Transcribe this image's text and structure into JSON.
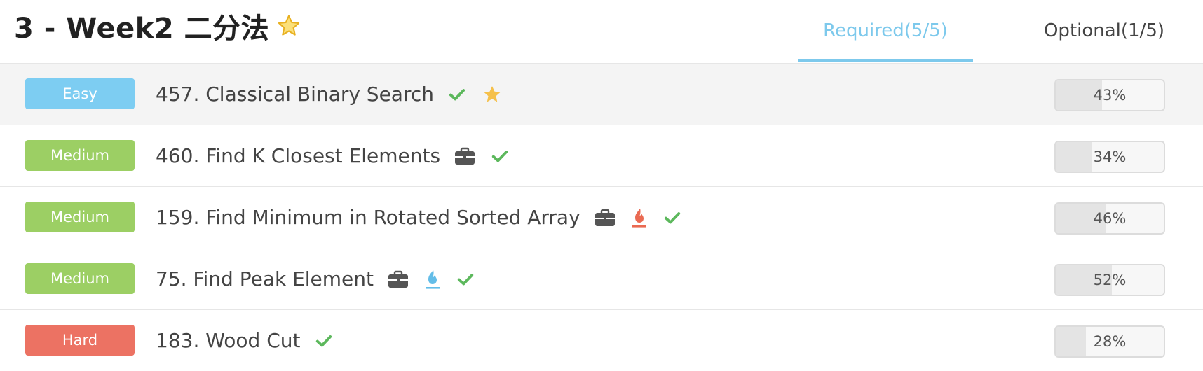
{
  "header": {
    "title": "3 - Week2 二分法",
    "title_icon": "star-outline-icon",
    "tabs": [
      {
        "label": "Required(5/5)",
        "active": true
      },
      {
        "label": "Optional(1/5)",
        "active": false
      }
    ]
  },
  "colors": {
    "accent": "#7dc9ec",
    "easy": "#7dcdf2",
    "medium": "#9ccf64",
    "hard": "#ec7263",
    "check": "#5cb85c",
    "star": "#f5c04a",
    "fire_red": "#ea6a52",
    "fire_blue": "#63bde8",
    "briefcase": "#555555"
  },
  "problems": [
    {
      "difficulty": "Easy",
      "title": "457. Classical Binary Search",
      "icons": [
        "check-icon",
        "star-icon"
      ],
      "progress": "43%",
      "progress_value": 43
    },
    {
      "difficulty": "Medium",
      "title": "460. Find K Closest Elements",
      "icons": [
        "briefcase-icon",
        "check-icon"
      ],
      "progress": "34%",
      "progress_value": 34
    },
    {
      "difficulty": "Medium",
      "title": "159. Find Minimum in Rotated Sorted Array",
      "icons": [
        "briefcase-icon",
        "fire-red-icon",
        "check-icon"
      ],
      "progress": "46%",
      "progress_value": 46
    },
    {
      "difficulty": "Medium",
      "title": "75. Find Peak Element",
      "icons": [
        "briefcase-icon",
        "fire-blue-icon",
        "check-icon"
      ],
      "progress": "52%",
      "progress_value": 52
    },
    {
      "difficulty": "Hard",
      "title": "183. Wood Cut",
      "icons": [
        "check-icon"
      ],
      "progress": "28%",
      "progress_value": 28
    }
  ]
}
